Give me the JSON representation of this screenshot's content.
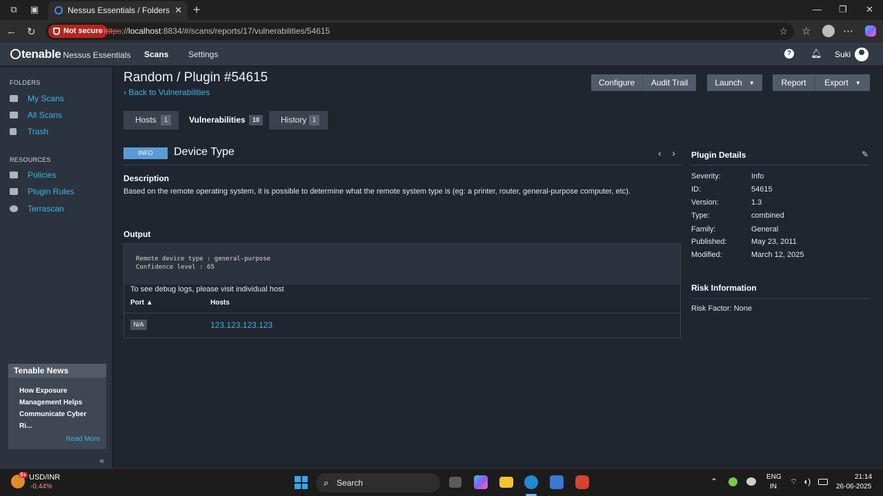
{
  "browser": {
    "tab_title": "Nessus Essentials / Folders / View",
    "not_secure": "Not secure",
    "url_proto": "https",
    "url_sep": "://",
    "url_host": "localhost",
    "url_rest": ":8834/#/scans/reports/17/vulnerabilities/54615"
  },
  "app": {
    "brand": "tenable",
    "product": "Nessus Essentials",
    "nav": [
      "Scans",
      "Settings"
    ],
    "user": "Suki"
  },
  "sidebar": {
    "folders_header": "FOLDERS",
    "folders": [
      "My Scans",
      "All Scans",
      "Trash"
    ],
    "resources_header": "RESOURCES",
    "resources": [
      "Policies",
      "Plugin Rules",
      "Terrascan"
    ],
    "news_header": "Tenable News",
    "news_text": "How Exposure Management Helps Communicate Cyber Ri...",
    "read_more": "Read More",
    "collapse": "«"
  },
  "page": {
    "title": "Random / Plugin #54615",
    "back": "‹ Back to Vulnerabilities",
    "buttons": {
      "configure": "Configure",
      "audit": "Audit Trail",
      "launch": "Launch",
      "report": "Report",
      "export": "Export"
    },
    "tabs": [
      {
        "label": "Hosts",
        "count": "1"
      },
      {
        "label": "Vulnerabilities",
        "count": "10"
      },
      {
        "label": "History",
        "count": "1"
      }
    ]
  },
  "vuln": {
    "severity_badge": "INFO",
    "name": "Device Type",
    "description_header": "Description",
    "description": "Based on the remote operating system, it is possible to determine what the remote system type is (eg: a printer, router, general-purpose computer, etc).",
    "output_header": "Output",
    "output_text": "Remote device type : general-purpose\nConfidence level : 65",
    "debug_text": "To see debug logs, please visit individual host",
    "col_port": "Port ▲",
    "col_hosts": "Hosts",
    "port_value": "N/A",
    "host_value": "123.123.123.123"
  },
  "plugin_details": {
    "header": "Plugin Details",
    "rows": [
      {
        "k": "Severity:",
        "v": "Info"
      },
      {
        "k": "ID:",
        "v": "54615"
      },
      {
        "k": "Version:",
        "v": "1.3"
      },
      {
        "k": "Type:",
        "v": "combined"
      },
      {
        "k": "Family:",
        "v": "General"
      },
      {
        "k": "Published:",
        "v": "May 23, 2011"
      },
      {
        "k": "Modified:",
        "v": "March 12, 2025"
      }
    ],
    "risk_header": "Risk Information",
    "risk_factor": "Risk Factor: None"
  },
  "taskbar": {
    "ticker_name": "USD/INR",
    "ticker_change": "-0.44%",
    "ticker_badge": "9+",
    "search": "Search",
    "lang1": "ENG",
    "lang2": "IN",
    "time": "21:14",
    "date": "26-06-2025"
  },
  "colors": {
    "accent": "#3fb4e8",
    "info": "#5b9bd5",
    "header_bg": "#323a46",
    "not_secure": "#b3261e"
  }
}
